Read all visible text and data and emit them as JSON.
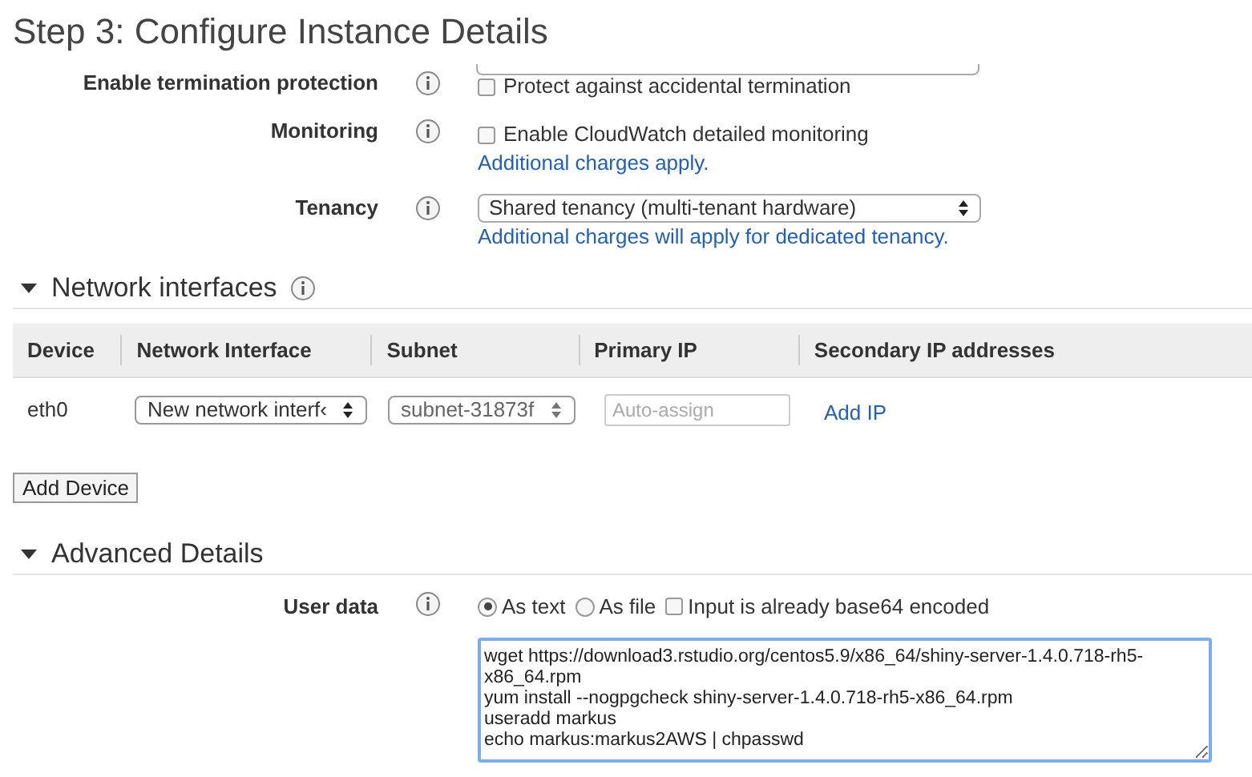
{
  "title": "Step 3: Configure Instance Details",
  "settings": [
    {
      "label": "Enable termination protection",
      "kind": "checkbox",
      "text": "Protect against accidental termination",
      "checked": false
    },
    {
      "label": "Monitoring",
      "kind": "checkbox",
      "text": "Enable CloudWatch detailed monitoring",
      "checked": false,
      "link": "Additional charges apply."
    },
    {
      "label": "Tenancy",
      "kind": "select",
      "value": "Shared tenancy (multi-tenant hardware)",
      "link": "Additional charges will apply for dedicated tenancy."
    }
  ],
  "network_interfaces": {
    "heading": "Network interfaces",
    "expanded": true,
    "columns": [
      "Device",
      "Network Interface",
      "Subnet",
      "Primary IP",
      "Secondary IP addresses"
    ],
    "rows": [
      {
        "device": "eth0",
        "network_interface": "New network interf‹",
        "subnet": "subnet-31873f",
        "primary_ip_placeholder": "Auto-assign",
        "link": "Add IP"
      }
    ],
    "add_button": "Add Device"
  },
  "advanced": {
    "heading": "Advanced Details",
    "expanded": true,
    "label": "User data",
    "options": [
      {
        "kind": "radio",
        "label": "As text",
        "selected": true
      },
      {
        "kind": "radio",
        "label": "As file",
        "selected": false
      },
      {
        "kind": "checkbox",
        "label": "Input is already base64 encoded",
        "checked": false
      }
    ],
    "user_data": [
      "wget https://download3.rstudio.org/centos5.9/x86_64/shiny-server-1.4.0.718-rh5-x86_64.rpm",
      "yum install --nogpgcheck shiny-server-1.4.0.718-rh5-x86_64.rpm",
      "useradd markus",
      "echo markus:markus2AWS | chpasswd"
    ]
  }
}
